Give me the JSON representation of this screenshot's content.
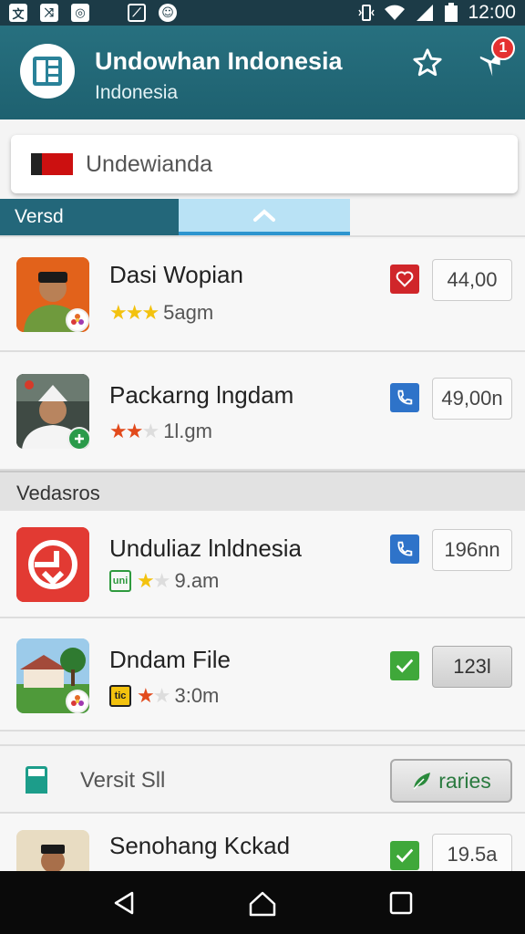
{
  "status_bar": {
    "time": "12:00",
    "left_icons": [
      "translate-icon",
      "shuffle-icon",
      "camera-icon",
      "image-icon",
      "face-icon"
    ],
    "right_icons": [
      "vibrate-icon",
      "wifi-icon",
      "signal-icon",
      "battery-icon"
    ]
  },
  "app_bar": {
    "title": "Undowhan Indonesia",
    "subtitle": "Indonesia",
    "notification_count": "1",
    "colors": {
      "background": "#23687a",
      "badge": "#e53030"
    }
  },
  "search": {
    "value": "Undewianda"
  },
  "tabs": {
    "left_label": "Versd",
    "right_icon": "chevron-up-icon"
  },
  "list_top": [
    {
      "title": "Dasi Wopian",
      "meta": "5agm",
      "stars_on": 3,
      "stars_total": 3,
      "star_color": "yellow",
      "action_icon": "heart-icon",
      "action_color": "#d0262a",
      "value": "44,00"
    },
    {
      "title": "Packarng lngdam",
      "meta": "1l.gm",
      "stars_on": 2,
      "stars_total": 3,
      "star_color": "red",
      "action_icon": "phone-icon",
      "action_color": "#2e73c9",
      "value": "49,00n"
    }
  ],
  "section": {
    "title": "Vedasros"
  },
  "list_bottom": [
    {
      "title": "Unduliaz lnldnesia",
      "meta": "9.am",
      "badge_text": "uni",
      "stars_on": 1,
      "stars_total": 2,
      "star_color": "yellow",
      "action_icon": "phone-icon",
      "action_color": "#2e73c9",
      "value": "196nn"
    },
    {
      "title": "Dndam File",
      "meta": "3:0m",
      "badge_text": "tic",
      "stars_on": 1,
      "stars_total": 2,
      "star_color": "red",
      "action_icon": "check-icon",
      "action_color": "#3fa83a",
      "value": "123l"
    }
  ],
  "footer_row": {
    "label": "Versit Sll",
    "button_label": "raries"
  },
  "last_row": {
    "title": "Senohang Kckad",
    "value": "19.5a",
    "action_icon": "check-icon"
  },
  "nav": {
    "buttons": [
      "back-icon",
      "home-icon",
      "recents-icon"
    ]
  }
}
